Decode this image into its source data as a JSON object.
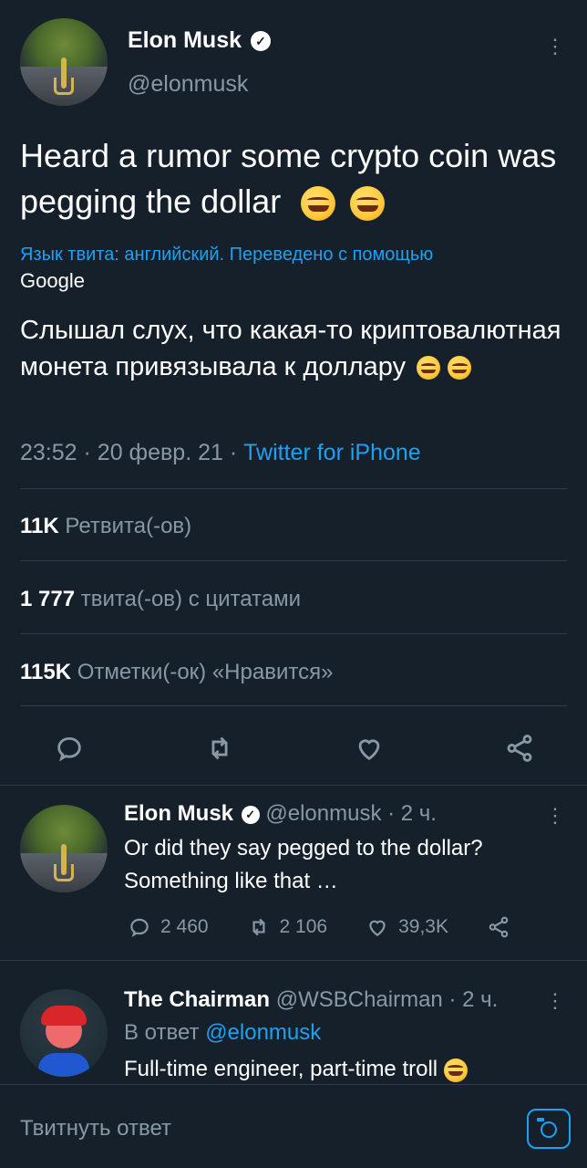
{
  "main_tweet": {
    "author": {
      "name": "Elon Musk",
      "handle": "@elonmusk"
    },
    "text": "Heard a rumor some crypto coin was pegging the dollar",
    "translation_note": "Язык твита: английский. Переведено с помощью",
    "translation_provider": "Google",
    "translated_text": "Слышал слух, что какая-то криптовалютная монета привязывала к доллару",
    "meta": {
      "time": "23:52",
      "date": "20 февр. 21",
      "source": "Twitter for iPhone"
    },
    "stats": [
      {
        "count": "11K",
        "label": "Ретвита(-ов)"
      },
      {
        "count": "1 777",
        "label": "твита(-ов) с цитатами"
      },
      {
        "count": "115K",
        "label": "Отметки(-ок) «Нравится»"
      }
    ]
  },
  "reply_1": {
    "author": {
      "name": "Elon Musk",
      "handle": "@elonmusk"
    },
    "time": "2 ч.",
    "text": "Or did they say pegged to the dollar? Something like that …",
    "actions": {
      "replies": "2 460",
      "retweets": "2 106",
      "likes": "39,3K"
    }
  },
  "reply_2": {
    "author": {
      "name": "The Chairman",
      "handle": "@WSBChairman"
    },
    "time": "2 ч.",
    "reply_to_prefix": "В ответ",
    "reply_to_handle": "@elonmusk",
    "text": "Full-time engineer, part-time troll"
  },
  "composer": {
    "placeholder": "Твитнуть ответ"
  },
  "icons": {
    "verified": "verified-badge-icon",
    "more": "more-vertical-icon",
    "reply": "reply-icon",
    "retweet": "retweet-icon",
    "like": "heart-icon",
    "share": "share-icon",
    "camera": "camera-icon"
  },
  "colors": {
    "background": "#15202b",
    "text_primary": "#ffffff",
    "text_secondary": "#8899a6",
    "accent": "#1da1f2",
    "divider": "#2f3b47"
  }
}
